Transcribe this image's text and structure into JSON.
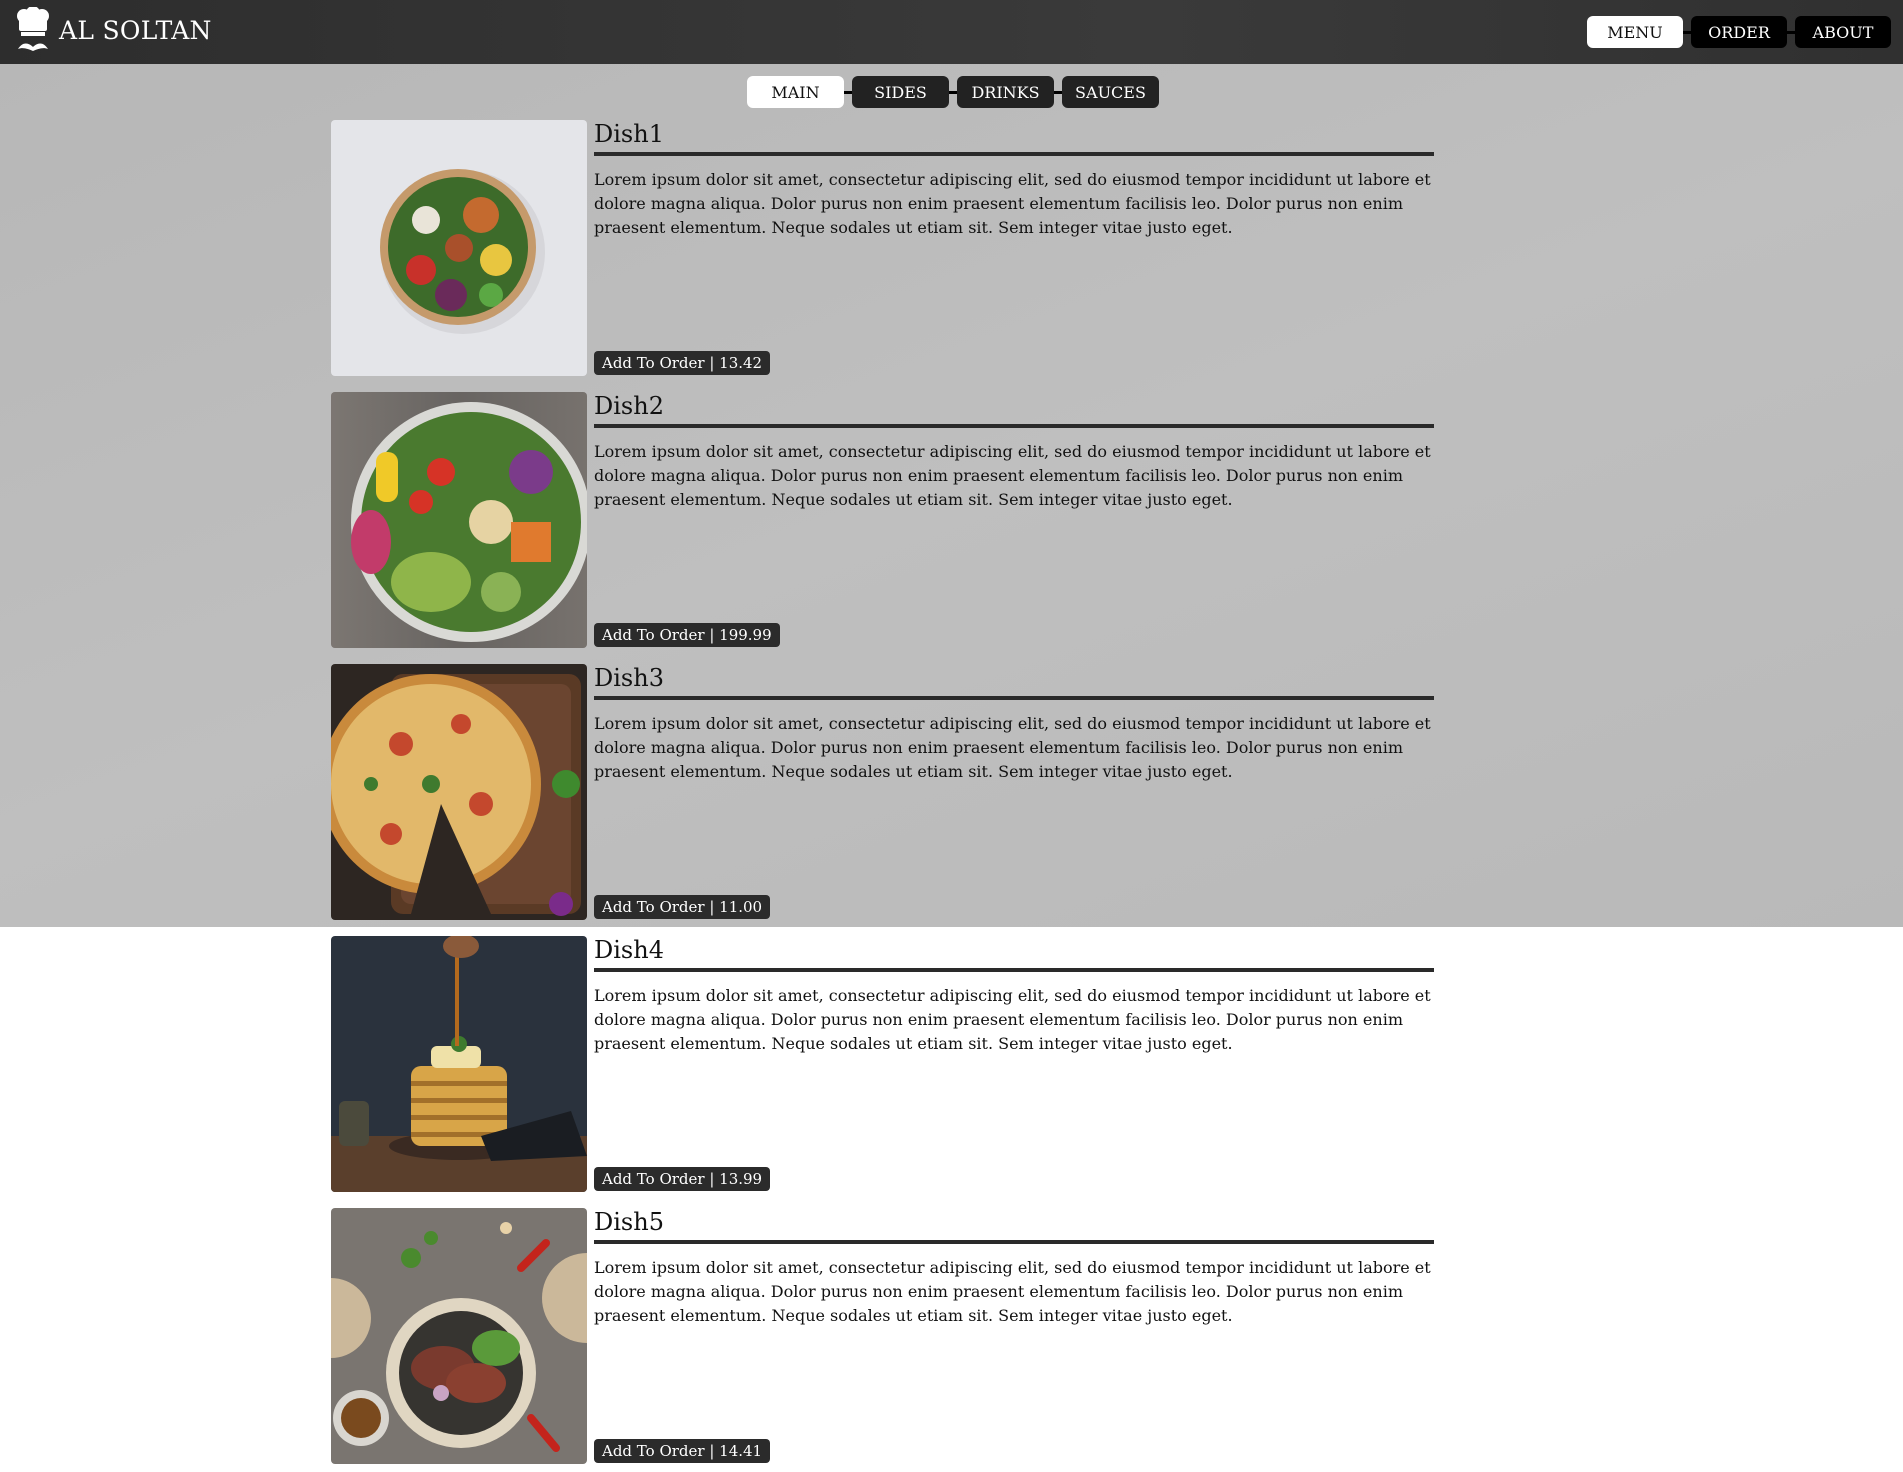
{
  "header": {
    "brand": "AL SOLTAN",
    "nav": [
      {
        "label": "MENU",
        "active": true
      },
      {
        "label": "ORDER",
        "active": false
      },
      {
        "label": "ABOUT",
        "active": false
      }
    ]
  },
  "tabs": [
    {
      "label": "MAIN",
      "active": true
    },
    {
      "label": "SIDES",
      "active": false
    },
    {
      "label": "DRINKS",
      "active": false
    },
    {
      "label": "SAUCES",
      "active": false
    }
  ],
  "dishes": [
    {
      "name": "Dish1",
      "description": "Lorem ipsum dolor sit amet, consectetur adipiscing elit, sed do eiusmod tempor incididunt ut labore et dolore magna aliqua. Dolor purus non enim praesent elementum facilisis leo. Dolor purus non enim praesent elementum. Neque sodales ut etiam sit. Sem integer vitae justo eget.",
      "button": "Add To Order | 13.42",
      "image": "salad-bowl-photo"
    },
    {
      "name": "Dish2",
      "description": "Lorem ipsum dolor sit amet, consectetur adipiscing elit, sed do eiusmod tempor incididunt ut labore et dolore magna aliqua. Dolor purus non enim praesent elementum facilisis leo. Dolor purus non enim praesent elementum. Neque sodales ut etiam sit. Sem integer vitae justo eget.",
      "button": "Add To Order | 199.99",
      "image": "vegetable-bowl-photo"
    },
    {
      "name": "Dish3",
      "description": "Lorem ipsum dolor sit amet, consectetur adipiscing elit, sed do eiusmod tempor incididunt ut labore et dolore magna aliqua. Dolor purus non enim praesent elementum facilisis leo. Dolor purus non enim praesent elementum. Neque sodales ut etiam sit. Sem integer vitae justo eget.",
      "button": "Add To Order | 11.00",
      "image": "pizza-photo"
    },
    {
      "name": "Dish4",
      "description": "Lorem ipsum dolor sit amet, consectetur adipiscing elit, sed do eiusmod tempor incididunt ut labore et dolore magna aliqua. Dolor purus non enim praesent elementum facilisis leo. Dolor purus non enim praesent elementum. Neque sodales ut etiam sit. Sem integer vitae justo eget.",
      "button": "Add To Order | 13.99",
      "image": "pancakes-photo"
    },
    {
      "name": "Dish5",
      "description": "Lorem ipsum dolor sit amet, consectetur adipiscing elit, sed do eiusmod tempor incididunt ut labore et dolore magna aliqua. Dolor purus non enim praesent elementum facilisis leo. Dolor purus non enim praesent elementum. Neque sodales ut etiam sit. Sem integer vitae justo eget.",
      "button": "Add To Order | 14.41",
      "image": "steak-plate-photo"
    }
  ],
  "colors": {
    "header_bg": "#333333",
    "band_bg": "#bbbbbb",
    "button_dark": "#222222",
    "button_active": "#ffffff"
  }
}
